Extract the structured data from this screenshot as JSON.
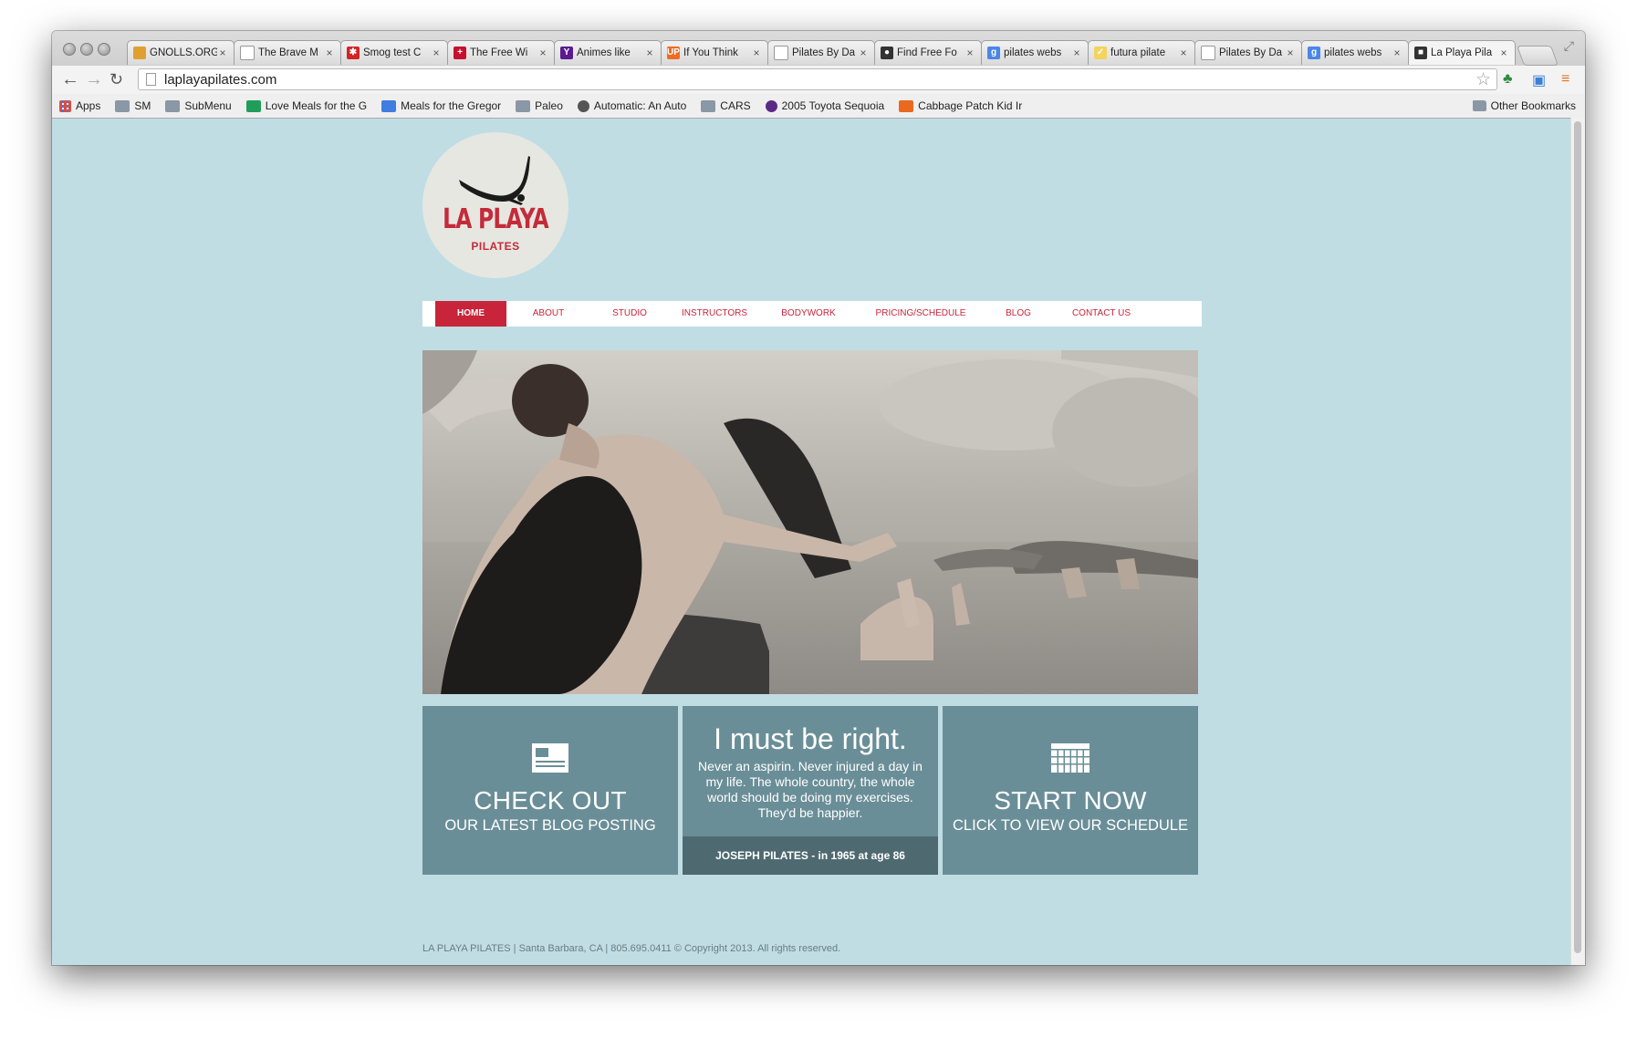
{
  "browser": {
    "tabs": [
      {
        "title": "GNOLLS.ORG",
        "color": "#e0a030",
        "glyph": ""
      },
      {
        "title": "The Brave M",
        "color": "#ffffff",
        "glyph": ""
      },
      {
        "title": "Smog test C",
        "color": "#d32323",
        "glyph": "✱"
      },
      {
        "title": "The Free Wi",
        "color": "#c8102e",
        "glyph": "+"
      },
      {
        "title": "Animes like",
        "color": "#5b1a8e",
        "glyph": "Y"
      },
      {
        "title": "If You Think",
        "color": "#f06a23",
        "glyph": "UP"
      },
      {
        "title": "Pilates By Da",
        "color": "#ffffff",
        "glyph": ""
      },
      {
        "title": "Find Free Fo",
        "color": "#333333",
        "glyph": "●"
      },
      {
        "title": "pilates webs",
        "color": "#4a86e8",
        "glyph": "g"
      },
      {
        "title": "futura pilate",
        "color": "#f4d35e",
        "glyph": "✓"
      },
      {
        "title": "Pilates By Da",
        "color": "#ffffff",
        "glyph": ""
      },
      {
        "title": "pilates webs",
        "color": "#4a86e8",
        "glyph": "g"
      },
      {
        "title": "La Playa Pila",
        "color": "#333333",
        "glyph": "■"
      }
    ],
    "url": "laplayapilates.com",
    "bookmarks": [
      {
        "label": "Apps",
        "type": "apps"
      },
      {
        "label": "SM",
        "type": "folder"
      },
      {
        "label": "SubMenu",
        "type": "folder"
      },
      {
        "label": "Love Meals for the G",
        "type": "sheet"
      },
      {
        "label": "Meals for the Gregor",
        "type": "doc"
      },
      {
        "label": "Paleo",
        "type": "folder"
      },
      {
        "label": "Automatic: An Auto",
        "type": "auto"
      },
      {
        "label": "CARS",
        "type": "folder"
      },
      {
        "label": "2005 Toyota Sequoia",
        "type": "peace"
      },
      {
        "label": "Cabbage Patch Kid Ir",
        "type": "etsy"
      }
    ],
    "other_bookmarks": "Other Bookmarks"
  },
  "site": {
    "logo": {
      "name": "LA PLAYA",
      "sub": "PILATES"
    },
    "nav": [
      {
        "label": "HOME",
        "active": true
      },
      {
        "label": "ABOUT",
        "active": false
      },
      {
        "label": "STUDIO",
        "active": false
      },
      {
        "label": "INSTRUCTORS",
        "active": false
      },
      {
        "label": "BODYWORK",
        "active": false
      },
      {
        "label": "PRICING/SCHEDULE",
        "active": false
      },
      {
        "label": "BLOG",
        "active": false
      },
      {
        "label": "CONTACT US",
        "active": false
      }
    ],
    "panels": {
      "blog": {
        "title": "CHECK OUT",
        "subtitle": "OUR LATEST BLOG POSTING",
        "icon": "newspaper-icon"
      },
      "quote": {
        "headline": "I must be right.",
        "body": "Never an aspirin. Never injured a day in my life. The whole country, the whole world should be doing my exercises. They'd be happier.",
        "attribution": "JOSEPH PILATES - in 1965 at age 86"
      },
      "schedule": {
        "title": "START NOW",
        "subtitle": "CLICK TO VIEW OUR SCHEDULE",
        "icon": "calendar-icon"
      }
    },
    "footer": "LA PLAYA PILATES | Santa Barbara, CA | 805.695.0411 © Copyright 2013. All rights reserved."
  },
  "colors": {
    "page_bg": "#c0dde4",
    "accent_red": "#c8243a",
    "panel": "#6a8e97",
    "panel_dark": "#4e6a70"
  }
}
